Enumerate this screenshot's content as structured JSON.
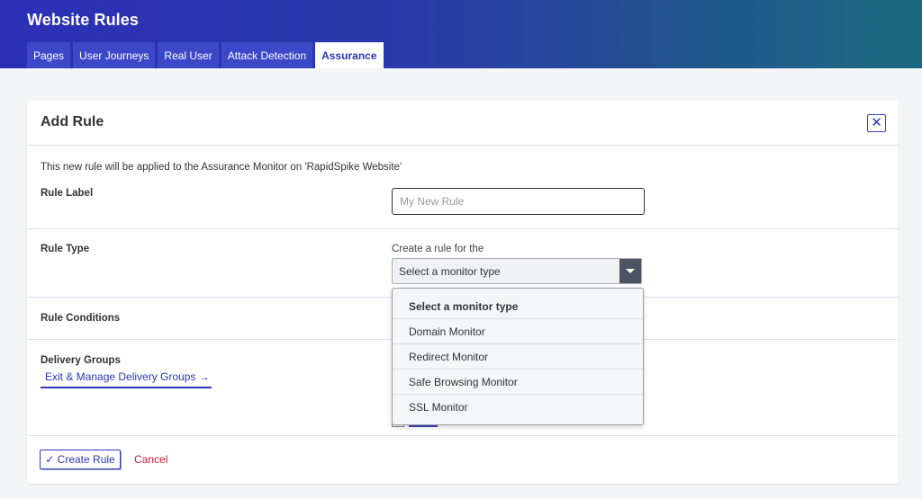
{
  "header": {
    "title": "Website Rules",
    "tabs": [
      {
        "label": "Pages",
        "active": false
      },
      {
        "label": "User Journeys",
        "active": false
      },
      {
        "label": "Real User",
        "active": false
      },
      {
        "label": "Attack Detection",
        "active": false
      },
      {
        "label": "Assurance",
        "active": true
      }
    ]
  },
  "modal": {
    "title": "Add Rule",
    "close_icon": "close-icon",
    "info": "This new rule will be applied to the Assurance Monitor on 'RapidSpike Website'",
    "rule_label": {
      "label": "Rule Label",
      "placeholder": "My New Rule",
      "value": ""
    },
    "rule_type": {
      "label": "Rule Type",
      "hint": "Create a rule for the",
      "selected": "Select a monitor type",
      "options": [
        "Select a monitor type",
        "Domain Monitor",
        "Redirect Monitor",
        "Safe Browsing Monitor",
        "SSL Monitor"
      ]
    },
    "rule_conditions": {
      "label": "Rule Conditions"
    },
    "delivery_groups": {
      "label": "Delivery Groups",
      "link": "Exit & Manage Delivery Groups →"
    },
    "actions": {
      "create": "✓ Create Rule",
      "cancel": "Cancel"
    }
  },
  "colors": {
    "brand": "#2b36b8",
    "header_gradient_start": "#2b2fb6",
    "header_gradient_end": "#1c6a82",
    "cancel": "#c0203c"
  }
}
